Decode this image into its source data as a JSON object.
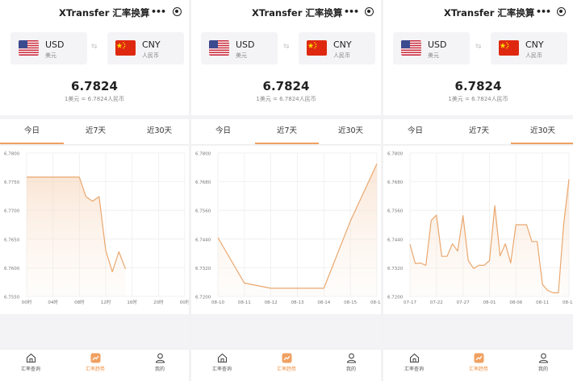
{
  "app": {
    "title": "XTransfer 汇率换算",
    "menu_icon": "more-dots-icon",
    "close_icon": "record-icon"
  },
  "converter": {
    "from": {
      "code": "USD",
      "name": "美元",
      "flag": "us-flag-icon"
    },
    "to": {
      "code": "CNY",
      "name": "人民币",
      "flag": "cn-flag-icon"
    },
    "swap_icon": "swap-arrows-icon",
    "rate": "6.7824",
    "rate_caption": "1美元 = 6.7824人民币"
  },
  "tabs": [
    "今日",
    "近7天",
    "近30天"
  ],
  "nav": [
    {
      "label": "汇率查询",
      "icon": "home-icon"
    },
    {
      "label": "汇率趋势",
      "icon": "trend-chart-icon"
    },
    {
      "label": "我的",
      "icon": "user-icon"
    }
  ],
  "colors": {
    "accent": "#F0A060",
    "line": "#E9A76E"
  },
  "screens": [
    {
      "active_tab": 0
    },
    {
      "active_tab": 1
    },
    {
      "active_tab": 2
    }
  ],
  "chart_data": [
    {
      "type": "line",
      "title": "今日",
      "x_ticks": [
        "00时",
        "04时",
        "08时",
        "12时",
        "16时",
        "20时",
        "00时"
      ],
      "y_ticks": [
        "6.7800",
        "6.7750",
        "6.7700",
        "6.7650",
        "6.7600",
        "6.7550"
      ],
      "ylim": [
        6.755,
        6.78
      ],
      "x": [
        0,
        2,
        4,
        6,
        8,
        9,
        10,
        11,
        12,
        13,
        14,
        15
      ],
      "values": [
        6.7758,
        6.7758,
        6.7758,
        6.7758,
        6.7758,
        6.7724,
        6.7716,
        6.7724,
        6.763,
        6.7593,
        6.7628,
        6.7598
      ],
      "xlim": [
        0,
        24
      ]
    },
    {
      "type": "area",
      "title": "近7天",
      "x_ticks": [
        "08-10",
        "08-11",
        "08-12",
        "08-13",
        "08-14",
        "08-15",
        "08-16"
      ],
      "y_ticks": [
        "6.7800",
        "6.7680",
        "6.7560",
        "6.7440",
        "6.7320",
        "6.7200"
      ],
      "ylim": [
        6.72,
        6.78
      ],
      "x": [
        0,
        1,
        2,
        3,
        4,
        5,
        6
      ],
      "values": [
        6.7446,
        6.7256,
        6.7234,
        6.7234,
        6.7234,
        6.7516,
        6.7755
      ],
      "xlim": [
        0,
        6
      ]
    },
    {
      "type": "area",
      "title": "近30天",
      "x_ticks": [
        "07-17",
        "07-22",
        "07-27",
        "08-01",
        "08-06",
        "08-11",
        "08-16"
      ],
      "y_ticks": [
        "6.7800",
        "6.7680",
        "6.7560",
        "6.7440",
        "6.7320",
        "6.7200"
      ],
      "ylim": [
        6.72,
        6.78
      ],
      "x": [
        0,
        1,
        2,
        3,
        4,
        5,
        6,
        7,
        8,
        9,
        10,
        11,
        12,
        13,
        14,
        15,
        16,
        17,
        18,
        19,
        20,
        21,
        22,
        23,
        24,
        25,
        26,
        27,
        28,
        29,
        30
      ],
      "values": [
        6.7418,
        6.7338,
        6.734,
        6.733,
        6.7518,
        6.754,
        6.7368,
        6.7368,
        6.742,
        6.739,
        6.7538,
        6.735,
        6.7317,
        6.733,
        6.733,
        6.735,
        6.758,
        6.737,
        6.742,
        6.734,
        6.75,
        6.75,
        6.75,
        6.743,
        6.743,
        6.725,
        6.7225,
        6.7215,
        6.7215,
        6.75,
        6.769
      ],
      "xlim": [
        0,
        30
      ]
    }
  ]
}
